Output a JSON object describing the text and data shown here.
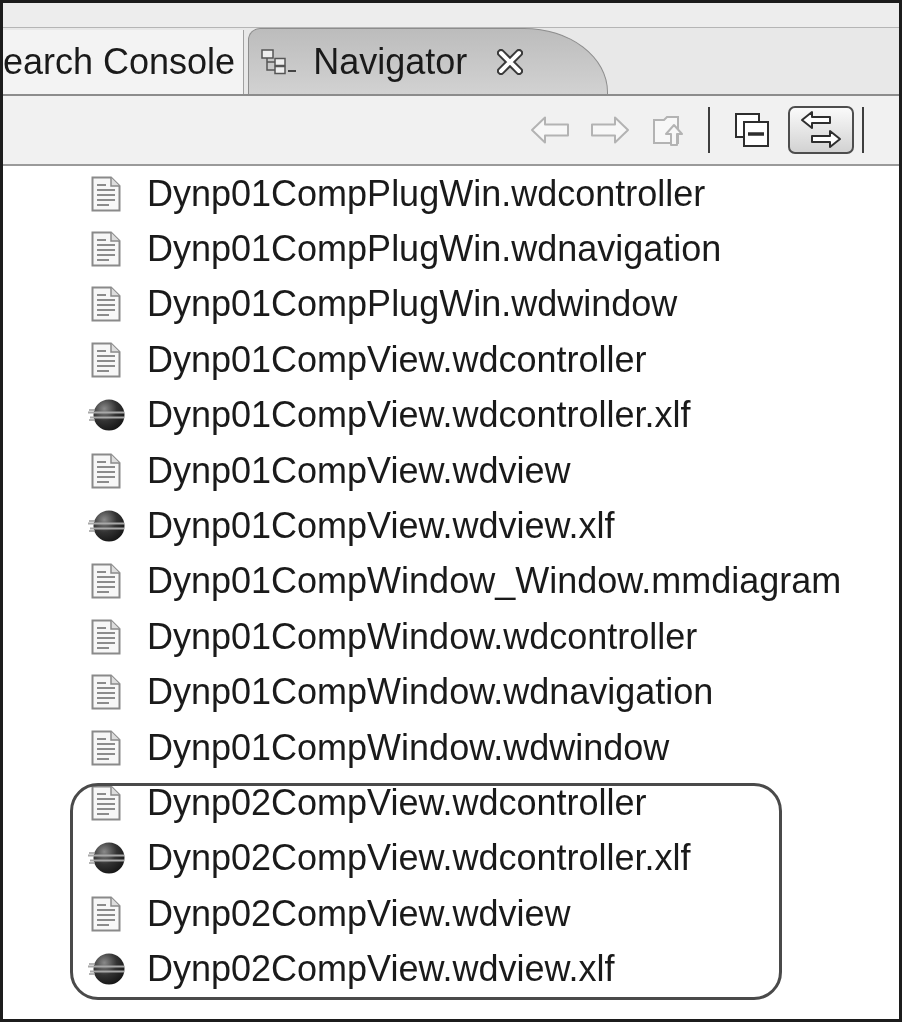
{
  "tabs": [
    {
      "label": "earch Console",
      "selected": false,
      "icon": false
    },
    {
      "label": "Navigator",
      "selected": true,
      "icon": true
    }
  ],
  "toolbar": {
    "groups": [
      [
        {
          "kind": "back",
          "disabled": true,
          "on": false
        },
        {
          "kind": "forward",
          "disabled": true,
          "on": false
        },
        {
          "kind": "up",
          "disabled": true,
          "on": false
        }
      ],
      [
        {
          "kind": "collapse",
          "disabled": false,
          "on": false
        },
        {
          "kind": "link",
          "disabled": false,
          "on": true
        }
      ]
    ]
  },
  "items": [
    {
      "name": "Dynp01CompPlugWin.wdcontroller",
      "kind": "document",
      "highlighted": false
    },
    {
      "name": "Dynp01CompPlugWin.wdnavigation",
      "kind": "document",
      "highlighted": false
    },
    {
      "name": "Dynp01CompPlugWin.wdwindow",
      "kind": "document",
      "highlighted": false
    },
    {
      "name": "Dynp01CompView.wdcontroller",
      "kind": "document",
      "highlighted": false
    },
    {
      "name": "Dynp01CompView.wdcontroller.xlf",
      "kind": "sphere",
      "highlighted": false
    },
    {
      "name": "Dynp01CompView.wdview",
      "kind": "document",
      "highlighted": false
    },
    {
      "name": "Dynp01CompView.wdview.xlf",
      "kind": "sphere",
      "highlighted": false
    },
    {
      "name": "Dynp01CompWindow_Window.mmdiagram",
      "kind": "document",
      "highlighted": false
    },
    {
      "name": "Dynp01CompWindow.wdcontroller",
      "kind": "document",
      "highlighted": false
    },
    {
      "name": "Dynp01CompWindow.wdnavigation",
      "kind": "document",
      "highlighted": false
    },
    {
      "name": "Dynp01CompWindow.wdwindow",
      "kind": "document",
      "highlighted": false
    },
    {
      "name": "Dynp02CompView.wdcontroller",
      "kind": "document",
      "highlighted": true
    },
    {
      "name": "Dynp02CompView.wdcontroller.xlf",
      "kind": "sphere",
      "highlighted": true
    },
    {
      "name": "Dynp02CompView.wdview",
      "kind": "document",
      "highlighted": true
    },
    {
      "name": "Dynp02CompView.wdview.xlf",
      "kind": "sphere",
      "highlighted": true
    }
  ]
}
